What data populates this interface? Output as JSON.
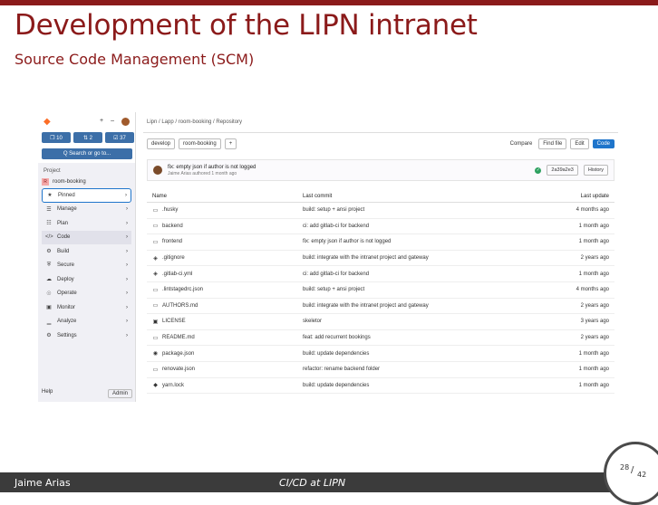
{
  "slide": {
    "title": "Development of the LIPN intranet",
    "subtitle": "Source Code Management (SCM)",
    "footer_author": "Jaime Arias",
    "footer_title": "CI/CD at LIPN",
    "page_current": "28",
    "page_total": "42",
    "accent_color": "#8b1a1a"
  },
  "screenshot": {
    "sidebar": {
      "top_icons": [
        "+",
        "–"
      ],
      "counters": [
        "❐ 10",
        "⇅ 2",
        "☑ 37"
      ],
      "search": "Q Search or go to...",
      "section": "Project",
      "project_badge": "R",
      "project_name": "room-booking",
      "items": [
        {
          "icon": "★",
          "label": "Pinned"
        },
        {
          "icon": "☰",
          "label": "Manage"
        },
        {
          "icon": "☷",
          "label": "Plan"
        },
        {
          "icon": "</>",
          "label": "Code"
        },
        {
          "icon": "⚙",
          "label": "Build"
        },
        {
          "icon": "⛨",
          "label": "Secure"
        },
        {
          "icon": "☁",
          "label": "Deploy"
        },
        {
          "icon": "☉",
          "label": "Operate"
        },
        {
          "icon": "▣",
          "label": "Monitor"
        },
        {
          "icon": "▁",
          "label": "Analyze"
        },
        {
          "icon": "⚙",
          "label": "Settings"
        }
      ],
      "chevron": "›",
      "help": "Help",
      "admin": "Admin"
    },
    "breadcrumb": "Lipn / Lapp / room-booking / Repository",
    "toolbar": {
      "branch": "develop",
      "path": "room-booking",
      "plus": "+",
      "compare": "Compare",
      "find_file": "Find file",
      "edit": "Edit",
      "code": "Code"
    },
    "commit": {
      "title": "fix: empty json if author is not logged",
      "meta": "Jaime Arias authored 1 month ago",
      "sha": "2a39a2e3",
      "history": "History"
    },
    "table": {
      "headers": [
        "Name",
        "Last commit",
        "Last update"
      ],
      "rows": [
        {
          "icon": "▭",
          "name": ".husky",
          "commit": "build: setup + ansi project",
          "updated": "4 months ago"
        },
        {
          "icon": "▭",
          "name": "backend",
          "commit": "ci: add gitlab-ci for backend",
          "updated": "1 month ago"
        },
        {
          "icon": "▭",
          "name": "frontend",
          "commit": "fix: empty json if author is not logged",
          "updated": "1 month ago"
        },
        {
          "icon": "◈",
          "name": ".gitignore",
          "commit": "build: integrate with the intranet project and gateway",
          "updated": "2 years ago"
        },
        {
          "icon": "◈",
          "name": ".gitlab-ci.yml",
          "commit": "ci: add gitlab-ci for backend",
          "updated": "1 month ago"
        },
        {
          "icon": "▭",
          "name": ".lintstagedrc.json",
          "commit": "build: setup + ansi project",
          "updated": "4 months ago"
        },
        {
          "icon": "▭",
          "name": "AUTHORS.md",
          "commit": "build: integrate with the intranet project and gateway",
          "updated": "2 years ago"
        },
        {
          "icon": "▣",
          "name": "LICENSE",
          "commit": "skeletor",
          "updated": "3 years ago"
        },
        {
          "icon": "▭",
          "name": "README.md",
          "commit": "feat: add recurrent bookings",
          "updated": "2 years ago"
        },
        {
          "icon": "◉",
          "name": "package.json",
          "commit": "build: update dependencies",
          "updated": "1 month ago"
        },
        {
          "icon": "▭",
          "name": "renovate.json",
          "commit": "refactor: rename backend folder",
          "updated": "1 month ago"
        },
        {
          "icon": "◆",
          "name": "yarn.lock",
          "commit": "build: update dependencies",
          "updated": "1 month ago"
        }
      ]
    }
  }
}
